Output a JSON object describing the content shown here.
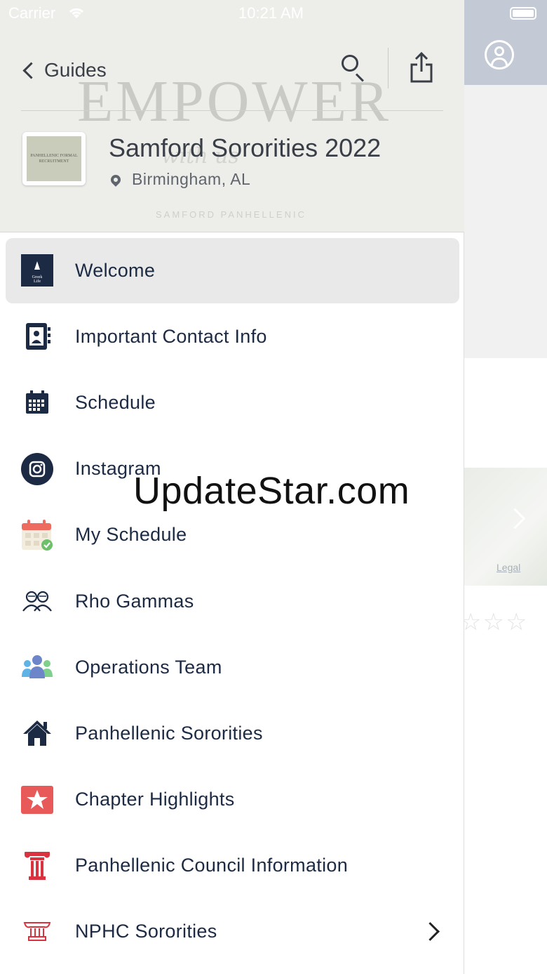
{
  "status_bar": {
    "carrier": "Carrier",
    "time": "10:21 AM"
  },
  "header": {
    "back_label": "Guides",
    "watermark_text": "EMPOWER",
    "watermark_script": "with us",
    "watermark_sub": "SAMFORD PANHELLENIC",
    "thumb_text": "PANHELLENIC FORMAL RECRUITMENT",
    "guide_title": "Samford Sororities 2022",
    "guide_location": "Birmingham, AL"
  },
  "menu": {
    "items": [
      {
        "label": "Welcome",
        "icon": "greek-life-logo-icon",
        "selected": true
      },
      {
        "label": "Important Contact Info",
        "icon": "contact-book-icon"
      },
      {
        "label": "Schedule",
        "icon": "calendar-icon"
      },
      {
        "label": "Instagram",
        "icon": "instagram-icon"
      },
      {
        "label": "My Schedule",
        "icon": "my-schedule-icon"
      },
      {
        "label": "Rho Gammas",
        "icon": "people-outline-icon"
      },
      {
        "label": "Operations Team",
        "icon": "team-icon"
      },
      {
        "label": "Panhellenic Sororities",
        "icon": "house-icon"
      },
      {
        "label": "Chapter Highlights",
        "icon": "star-badge-icon"
      },
      {
        "label": "Panhellenic Council Information",
        "icon": "column-icon"
      },
      {
        "label": "NPHC Sororities",
        "icon": "column-outline-icon",
        "has_chevron": true
      }
    ]
  },
  "right_panel": {
    "legal_label": "Legal",
    "stars": "☆☆☆"
  },
  "overlay_watermark": "UpdateStar.com",
  "colors": {
    "navy": "#1c2a44",
    "red": "#d9333f",
    "header_bg": "#ededea",
    "selected_bg": "#e9e9e9"
  }
}
